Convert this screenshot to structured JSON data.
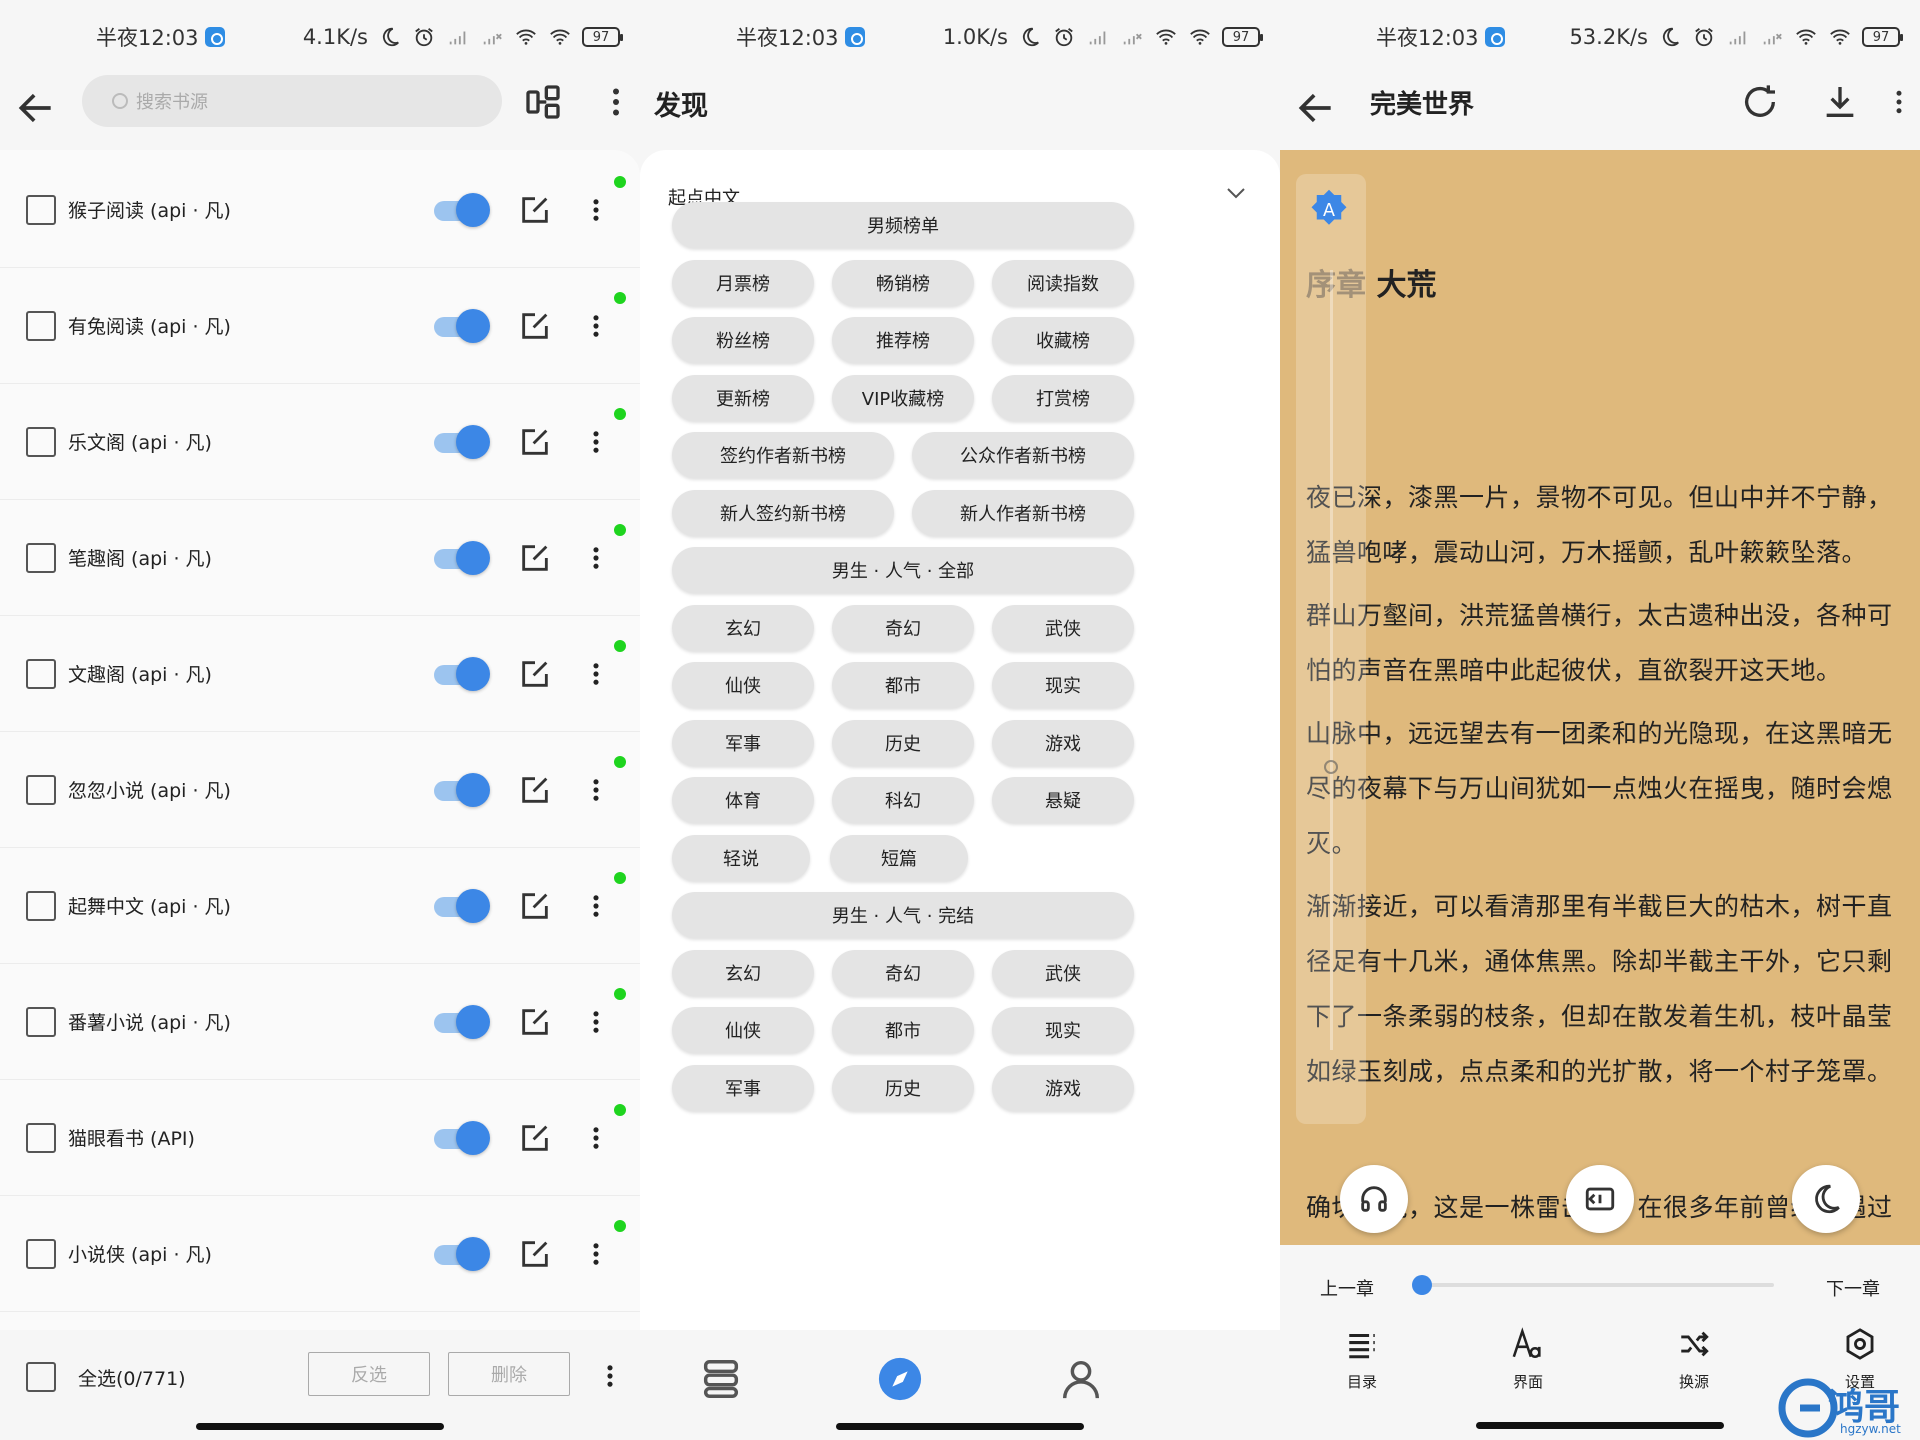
{
  "status": [
    {
      "time": "半夜12:03",
      "speed": "4.1K/s",
      "battery": "97"
    },
    {
      "time": "半夜12:03",
      "speed": "1.0K/s",
      "battery": "97"
    },
    {
      "time": "半夜12:03",
      "speed": "53.2K/s",
      "battery": "97"
    }
  ],
  "sources": {
    "search_placeholder": "搜索书源",
    "items": [
      {
        "label": "猴子阅读 (api · 凡)",
        "enabled": true
      },
      {
        "label": "有兔阅读 (api · 凡)",
        "enabled": true
      },
      {
        "label": "乐文阁 (api · 凡)",
        "enabled": true
      },
      {
        "label": "笔趣阁 (api · 凡)",
        "enabled": true
      },
      {
        "label": "文趣阁 (api · 凡)",
        "enabled": true
      },
      {
        "label": "忽忽小说 (api · 凡)",
        "enabled": true
      },
      {
        "label": "起舞中文 (api · 凡)",
        "enabled": true
      },
      {
        "label": "番薯小说 (api · 凡)",
        "enabled": true
      },
      {
        "label": "猫眼看书 (API)",
        "enabled": true
      },
      {
        "label": "小说侠 (api · 凡)",
        "enabled": true
      }
    ],
    "select_all": "全选(0/771)",
    "invert": "反选",
    "delete": "删除",
    "status_color": "#1ed41e",
    "accent": "#3c87e6"
  },
  "discover": {
    "title": "发现",
    "source": "起点中文",
    "chips": [
      "男频榜单",
      "月票榜",
      "畅销榜",
      "阅读指数",
      "粉丝榜",
      "推荐榜",
      "收藏榜",
      "更新榜",
      "VIP收藏榜",
      "打赏榜",
      "签约作者新书榜",
      "公众作者新书榜",
      "新人签约新书榜",
      "新人作者新书榜",
      "男生 · 人气 · 全部",
      "玄幻",
      "奇幻",
      "武侠",
      "仙侠",
      "都市",
      "现实",
      "军事",
      "历史",
      "游戏",
      "体育",
      "科幻",
      "悬疑",
      "轻说",
      "短篇",
      "男生 · 人气 · 完结",
      "玄幻",
      "奇幻",
      "武侠",
      "仙侠",
      "都市",
      "现实",
      "军事",
      "历史",
      "游戏"
    ]
  },
  "reader": {
    "title": "完美世界",
    "badge": "A",
    "chapter_prefix": "序章",
    "chapter_name": "大荒",
    "paragraphs": [
      "夜已深，漆黑一片，景物不可见。但山中并不宁静，猛兽咆哮，震动山河，万木摇颤，乱叶簌簌坠落。",
      "群山万壑间，洪荒猛兽横行，太古遗种出没，各种可怕的声音在黑暗中此起彼伏，直欲裂开这天地。",
      "山脉中，远远望去有一团柔和的光隐现，在这黑暗无尽的夜幕下与万山间犹如一点烛火在摇曳，随时会熄灭。",
      "渐渐接近，可以看清那里有半截巨大的枯木，树干直径足有十几米，通体焦黑。除却半截主干外，它只剩下了一条柔弱的枝条，但却在散发着生机，枝叶晶莹如绿玉刻成，点点柔和的光扩散，将一个村子笼罩。",
      "确切的说，这是一株雷击木，在很多年前曾经遭遇过"
    ],
    "prev": "上一章",
    "next": "下一章",
    "progress": 0,
    "tools": [
      "目录",
      "界面",
      "换源",
      "设置"
    ],
    "bg_color": "#dfb97c"
  },
  "watermark": {
    "text": "鸿哥网",
    "sub": "hgzyw.net"
  }
}
